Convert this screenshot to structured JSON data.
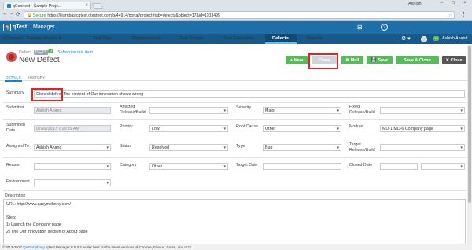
{
  "browser": {
    "tab_title": "qConnect - Sample Proje...",
    "tab_close": "×",
    "user_chip": "Ashish",
    "window_minimize": "–",
    "window_maximize": "□",
    "window_close": "×",
    "nav_back": "←",
    "nav_forward": "→",
    "nav_reload": "⟳",
    "secure_label": "🔒 Secure",
    "url": "https://learnbasicqtest.qtestnet.com/p/44914/portal/project#tab=defects&object=17&id=1103495",
    "bookmark_icon": "☆",
    "menu_icon": "⋮"
  },
  "app": {
    "logo_letter": "q",
    "logo_text": "qTest",
    "app_name": "Manager",
    "project_selector": "qConnect - Sample Project ▾",
    "nav": [
      "Test Plan",
      "Requirements",
      "Test Design",
      "Test Execution",
      "Defects",
      "Reports"
    ],
    "grid_icon": "⊞",
    "help_icon": "?",
    "gear_icon": "⚙ ▾",
    "notif_count": "13",
    "user_name": "Ashish Anand"
  },
  "defect": {
    "breadcrumb_label": "Defect",
    "id": "DF-13",
    "count": "0",
    "subscribe": "Subscribe this item",
    "title": "New Defect"
  },
  "toolbar": {
    "new": "+ New",
    "clone": "Clone",
    "mail": "✉ Mail",
    "save": "💾 Save",
    "save_close": "Save & Close",
    "close": "✕ Close"
  },
  "tabs": {
    "details": "DETAILS",
    "history": "HISTORY"
  },
  "form": {
    "summary_label": "Summary",
    "summary_prefix": "Cloned defect",
    "summary_value": "The content of Our innovation shows wrong",
    "submitter_label": "Submitter",
    "submitter_value": "Ashish Anand",
    "affected_label": "Affected Release/Build",
    "severity_label": "Severity",
    "severity_value": "Major",
    "fixed_label": "Fixed Release/Build",
    "submitted_label": "Submitted Date",
    "submitted_value": "07/28/2017 7:10:29 AM",
    "priority_label": "Priority",
    "priority_value": "Low",
    "root_cause_label": "Root Cause",
    "root_cause_value": "Other",
    "module_label": "Module",
    "module_value": "MD-1 MD-6 Company page",
    "assigned_label": "Assigned To",
    "assigned_value": "Ashish Anand",
    "status_label": "Status",
    "status_value": "Resolved",
    "type_label": "Type",
    "type_value": "Bug",
    "target_label": "Target Release/Build",
    "reason_label": "Reason",
    "category_label": "Category",
    "category_value": "Other",
    "target_date_label": "Target Date",
    "closed_date_label": "Closed Date",
    "environment_label": "Environment",
    "description_label": "Description",
    "description_lines": [
      "URL: http://www.qasymphony.com/",
      "",
      "Step:",
      "1) Launch the Company page",
      "2) The Our innovation section of About page"
    ]
  },
  "footer": {
    "copyright": "©2013-2017",
    "company": "QASymphony",
    "note": ". qTest Manager 8.5.3.2 works best on the latest versions of Chrome, Firefox, Safari, and IE11."
  }
}
